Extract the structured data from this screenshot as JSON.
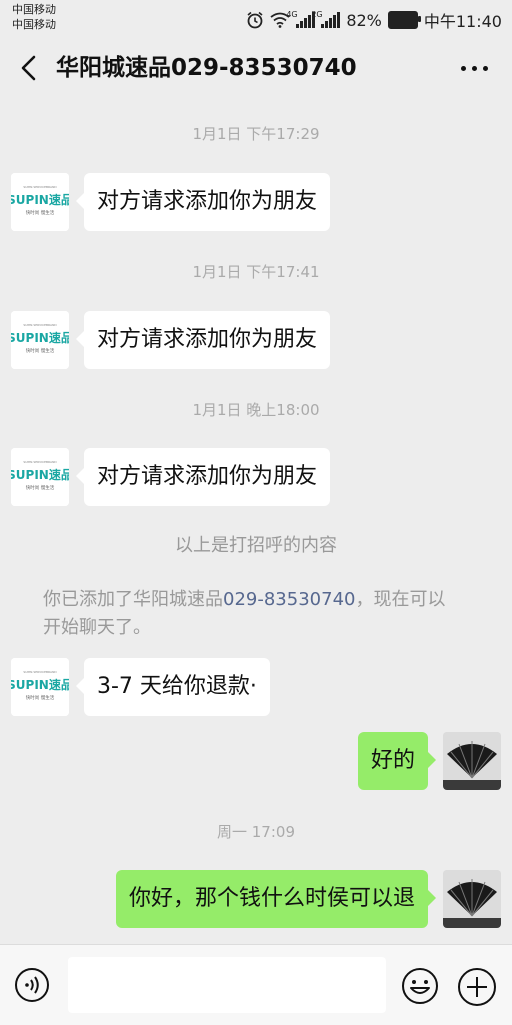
{
  "status_bar": {
    "carrier1": "中国移动",
    "carrier2": "中国移动",
    "net1": "4G",
    "net2": "2G",
    "battery": "82%",
    "time": "中午11:40"
  },
  "header": {
    "title": "华阳城速品029-83530740"
  },
  "brand_avatar": {
    "top_text": "SUPIN·SERVICEBRAND",
    "logo": "SUPIN速品",
    "slogan": "快时尚 慢生活"
  },
  "messages": [
    {
      "type": "timestamp",
      "text": "1月1日 下午17:29"
    },
    {
      "type": "incoming",
      "text": "对方请求添加你为朋友"
    },
    {
      "type": "timestamp",
      "text": "1月1日 下午17:41"
    },
    {
      "type": "incoming",
      "text": "对方请求添加你为朋友"
    },
    {
      "type": "timestamp",
      "text": "1月1日 晚上18:00"
    },
    {
      "type": "incoming",
      "text": "对方请求添加你为朋友"
    },
    {
      "type": "system",
      "text": "以上是打招呼的内容"
    },
    {
      "type": "system_rich",
      "prefix": "你已添加了华阳城速品",
      "number": "029-83530740",
      "suffix": "，现在可以",
      "line2": "开始聊天了。"
    },
    {
      "type": "incoming",
      "text": "3-7 天给你退款·"
    },
    {
      "type": "outgoing",
      "text": "好的"
    },
    {
      "type": "timestamp",
      "text": "周一 17:09"
    },
    {
      "type": "outgoing",
      "text": "你好，那个钱什么时侯可以退"
    }
  ],
  "icons": {
    "back": "back-chevron-icon",
    "more": "more-dots-icon",
    "voice": "voice-icon",
    "emoji": "emoji-icon",
    "plus": "plus-icon",
    "alarm": "alarm-icon",
    "wifi": "wifi-icon"
  },
  "colors": {
    "background": "#ededed",
    "outgoing_bubble": "#95ec69",
    "incoming_bubble": "#ffffff",
    "link": "#57688f",
    "brand_teal": "#1aa7a3"
  }
}
